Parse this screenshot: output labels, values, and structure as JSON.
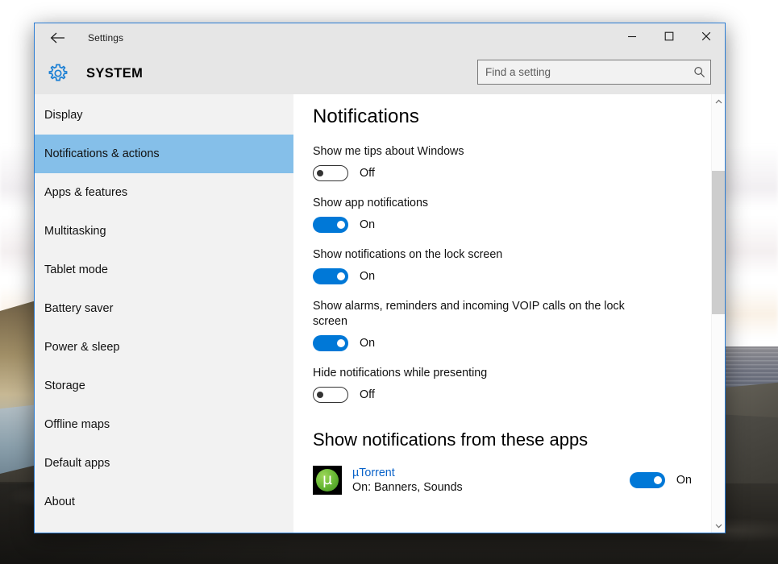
{
  "window": {
    "titlebar": {
      "back_icon": "back-arrow-icon",
      "title": "Settings",
      "minimize_label": "—",
      "maximize_label": "❑",
      "close_label": "✕"
    },
    "header": {
      "icon": "gear-icon",
      "title": "SYSTEM"
    },
    "search": {
      "placeholder": "Find a setting",
      "value": "",
      "icon": "search-icon"
    },
    "border_color": "#2b7cd3",
    "chrome_color": "#e6e6e6"
  },
  "sidebar": {
    "items": [
      {
        "label": "Display",
        "selected": false
      },
      {
        "label": "Notifications & actions",
        "selected": true
      },
      {
        "label": "Apps & features",
        "selected": false
      },
      {
        "label": "Multitasking",
        "selected": false
      },
      {
        "label": "Tablet mode",
        "selected": false
      },
      {
        "label": "Battery saver",
        "selected": false
      },
      {
        "label": "Power & sleep",
        "selected": false
      },
      {
        "label": "Storage",
        "selected": false
      },
      {
        "label": "Offline maps",
        "selected": false
      },
      {
        "label": "Default apps",
        "selected": false
      },
      {
        "label": "About",
        "selected": false
      }
    ],
    "selected_color": "#85bfe9",
    "background_color": "#f2f2f2"
  },
  "main": {
    "section_title": "Notifications",
    "settings": [
      {
        "label": "Show me tips about Windows",
        "state": "Off",
        "on": false
      },
      {
        "label": "Show app notifications",
        "state": "On",
        "on": true
      },
      {
        "label": "Show notifications on the lock screen",
        "state": "On",
        "on": true
      },
      {
        "label": "Show alarms, reminders and incoming VOIP calls on the lock screen",
        "state": "On",
        "on": true
      },
      {
        "label": "Hide notifications while presenting",
        "state": "Off",
        "on": false
      }
    ],
    "apps_heading": "Show notifications from these apps",
    "apps": [
      {
        "name": "µTorrent",
        "subtitle": "On: Banners, Sounds",
        "state": "On",
        "on": true,
        "icon": "utorrent-icon",
        "icon_glyph": "µ"
      }
    ],
    "toggle_on_color": "#0078d7",
    "link_color": "#0a63c9"
  },
  "scrollbar": {
    "up_icon": "chevron-up-icon",
    "down_icon": "chevron-down-icon",
    "thumb_color": "#cdcdcd"
  }
}
